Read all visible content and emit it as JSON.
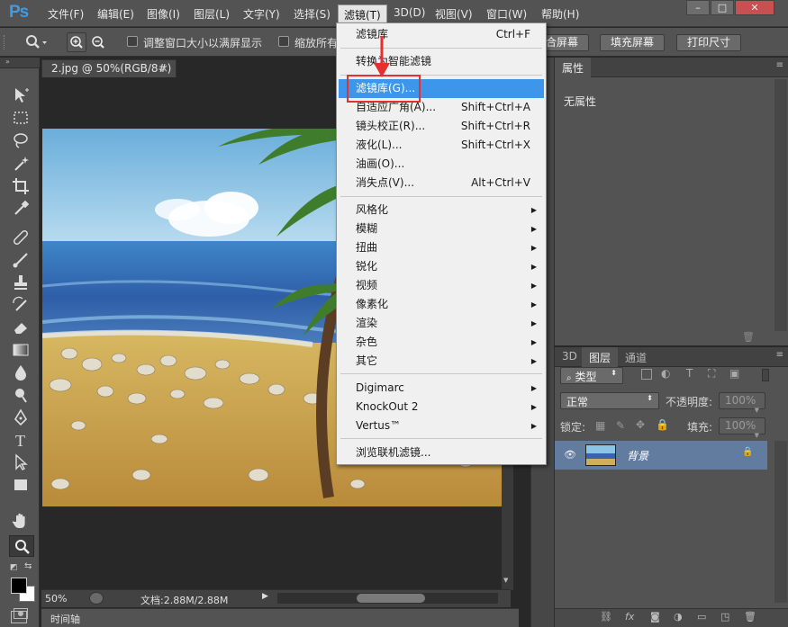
{
  "app": {
    "logo": "Ps"
  },
  "menubar": {
    "items": [
      "文件(F)",
      "编辑(E)",
      "图像(I)",
      "图层(L)",
      "文字(Y)",
      "选择(S)",
      "滤镜(T)",
      "3D(D)",
      "视图(V)",
      "窗口(W)",
      "帮助(H)"
    ],
    "active_item": "滤镜(T)"
  },
  "options_bar": {
    "resize_windows_label": "调整窗口大小以满屏显示",
    "zoom_all_label": "缩放所有",
    "fit_screen_button": "合屏幕",
    "fill_screen_button": "填充屏幕",
    "print_size_button": "打印尺寸"
  },
  "document": {
    "tab_title": "2.jpg @ 50%(RGB/8#)",
    "tab_close": "×",
    "zoom": "50%",
    "doc_size": "文档:2.88M/2.88M",
    "timeline_label": "时间轴"
  },
  "filter_menu": {
    "items_group1": [
      {
        "label": "滤镜库",
        "shortcut": "Ctrl+F"
      }
    ],
    "items_group2": [
      {
        "label": "转换为智能滤镜"
      }
    ],
    "items_group3": [
      {
        "label": "滤镜库(G)...",
        "highlighted": true
      },
      {
        "label": "自适应广角(A)...",
        "shortcut": "Shift+Ctrl+A"
      },
      {
        "label": "镜头校正(R)...",
        "shortcut": "Shift+Ctrl+R"
      },
      {
        "label": "液化(L)...",
        "shortcut": "Shift+Ctrl+X"
      },
      {
        "label": "油画(O)..."
      },
      {
        "label": "消失点(V)...",
        "shortcut": "Alt+Ctrl+V"
      }
    ],
    "items_group4": [
      "风格化",
      "模糊",
      "扭曲",
      "锐化",
      "视频",
      "像素化",
      "渲染",
      "杂色",
      "其它"
    ],
    "items_group5": [
      "Digimarc",
      "KnockOut 2",
      "Vertus™"
    ],
    "items_group6": [
      {
        "label": "浏览联机滤镜..."
      }
    ]
  },
  "properties_panel": {
    "tab_label": "属性",
    "content": "无属性"
  },
  "layers_panel": {
    "tabs": [
      "3D",
      "图层",
      "通道"
    ],
    "active_tab": "图层",
    "filter_kind": "类型",
    "blend_mode": "正常",
    "opacity_label": "不透明度:",
    "opacity_value": "100%",
    "lock_label": "锁定:",
    "fill_label": "填充:",
    "fill_value": "100%",
    "layer_name": "背景"
  },
  "colors": {
    "menu_highlight": "#3d96ea",
    "annotation_red": "#e53030",
    "panel_bg": "#535353",
    "canvas_bg": "#282828"
  }
}
